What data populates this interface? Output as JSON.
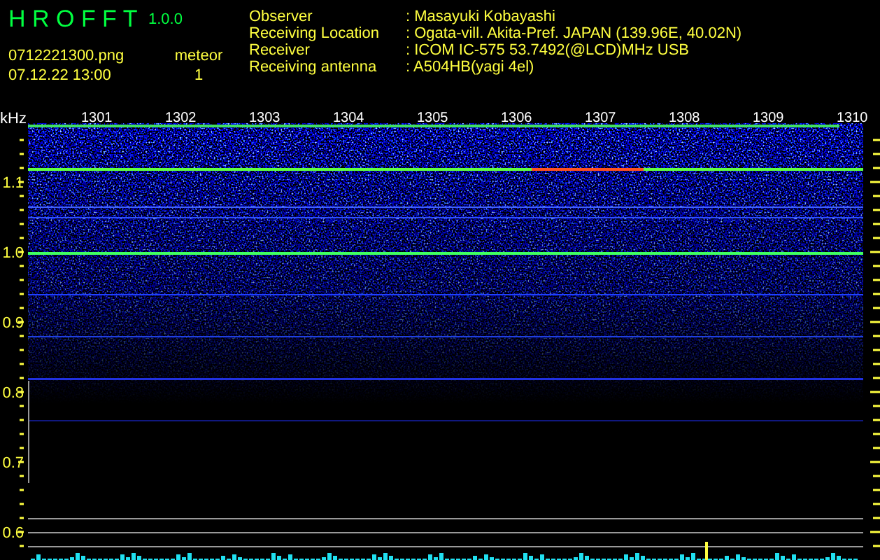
{
  "app": {
    "title": "H R O F F T",
    "version": "1.0.0",
    "file_name": "0712221300.png",
    "timestamp": "07.12.22 13:00",
    "meteor_label": "meteor",
    "meteor_count": "1"
  },
  "info": [
    {
      "label": "Observer",
      "value": ": Masayuki Kobayashi"
    },
    {
      "label": "Receiving Location",
      "value": ": Ogata-vill. Akita-Pref. JAPAN (139.96E, 40.02N)"
    },
    {
      "label": "Receiver",
      "value": ": ICOM IC-575 53.7492(@LCD)MHz USB"
    },
    {
      "label": "Receiving antenna",
      "value": ": A504HB(yagi 4el)"
    }
  ],
  "plot": {
    "unit": "kHz",
    "y_labels": [
      "1.1",
      "1.0",
      "0.9",
      "0.8",
      "0.7",
      "0.6"
    ],
    "time_labels": [
      "1301",
      "1302",
      "1303",
      "1304",
      "1305",
      "1306",
      "1307",
      "1308",
      "1309",
      "1310"
    ]
  }
}
